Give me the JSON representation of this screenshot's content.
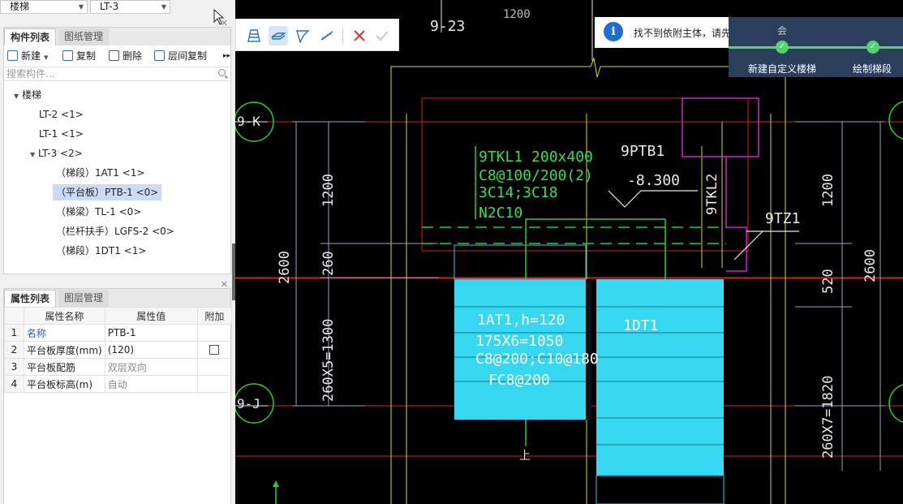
{
  "selectors": {
    "floor": "楼梯",
    "component": "LT-3"
  },
  "component_panel": {
    "tabs": [
      "构件列表",
      "图纸管理"
    ],
    "toolbar": {
      "new": "新建",
      "copy": "复制",
      "delete": "删除",
      "floor_copy": "层间复制"
    },
    "search_placeholder": "搜索构件...",
    "tree": {
      "root": "楼梯",
      "items": [
        "LT-2 <1>",
        "LT-1 <1>",
        "LT-3 <2>"
      ],
      "children": [
        "（梯段）1AT1 <1>",
        "（平台板）PTB-1 <0>",
        "（梯梁）TL-1 <0>",
        "（栏杆扶手）LGFS-2 <0>",
        "（梯段）1DT1 <1>"
      ]
    }
  },
  "property_panel": {
    "tabs": [
      "属性列表",
      "图层管理"
    ],
    "headers": [
      "属性名称",
      "属性值",
      "附加"
    ],
    "rows": [
      {
        "n": "1",
        "name": "名称",
        "value": "PTB-1"
      },
      {
        "n": "2",
        "name": "平台板厚度(mm)",
        "value": "(120)"
      },
      {
        "n": "3",
        "name": "平台板配筋",
        "value": "双层双向"
      },
      {
        "n": "4",
        "name": "平台板标高(m)",
        "value": "自动"
      }
    ]
  },
  "toast": {
    "message": "找不到依附主体，请先绘制梯段"
  },
  "wizard": {
    "steps": [
      "新建自定义楼梯",
      "绘制梯段"
    ],
    "partial": "会"
  },
  "cad": {
    "axis_top": "9-23",
    "axis_left_top": "9-K",
    "axis_left_bottom": "9-J",
    "beam_lines": [
      "9TKL1 200x400",
      "C8@100/200(2)",
      "3C14;3C18",
      "N2C10"
    ],
    "ptb": "9PTB1",
    "elevation": "-8.300",
    "tkl2": "9TKL2",
    "tz1": "9TZ1",
    "stair1": [
      "1AT1,h=120",
      "175X6=1050",
      "C8@200;C10@180",
      "FC8@200"
    ],
    "stair2": "1DT1",
    "dims_left": [
      "1200",
      "260",
      "2600",
      "260X5=1300"
    ],
    "dims_right": [
      "1200",
      "520",
      "2600",
      "260X7=1820"
    ],
    "up": "上",
    "top_partial": "1200"
  }
}
